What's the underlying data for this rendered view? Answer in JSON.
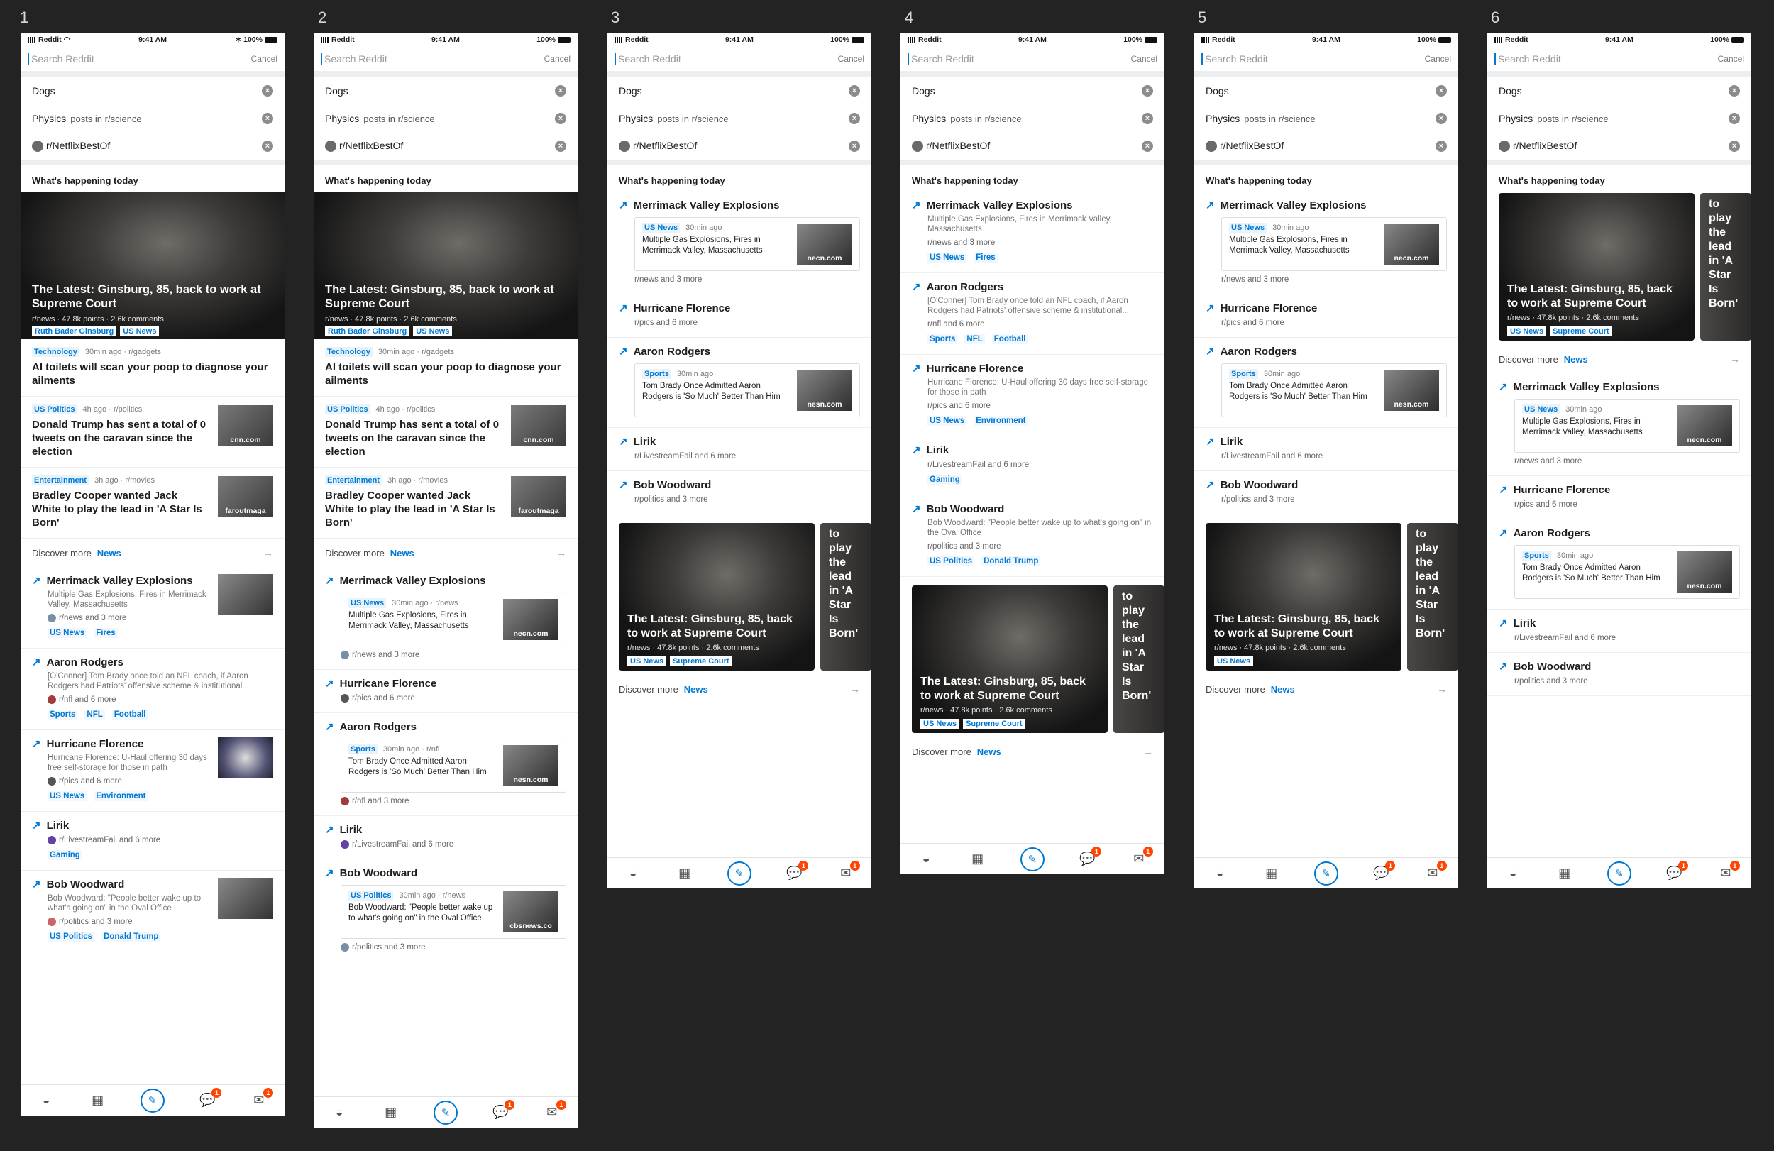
{
  "frame_labels": [
    "1",
    "2",
    "3",
    "4",
    "5",
    "6"
  ],
  "status": {
    "carrier": "Reddit",
    "time": "9:41 AM",
    "battery": "100%"
  },
  "search": {
    "placeholder": "Search Reddit",
    "cancel": "Cancel"
  },
  "recent": [
    {
      "label": "Dogs",
      "sub": ""
    },
    {
      "label": "Physics",
      "sub": "posts in r/science"
    },
    {
      "label": "r/NetflixBestOf",
      "sub": ""
    }
  ],
  "section_title": "What's happening today",
  "hero": {
    "title": "The Latest: Ginsburg, 85, back to work at Supreme Court",
    "meta": "r/news · 47.8k points · 2.6k comments",
    "tags_a": [
      "Ruth Bader Ginsburg",
      "US News"
    ],
    "tags_b": [
      "US News",
      "Supreme Court"
    ],
    "next_title": "Bradley Cooper wanted Jack White to play the lead in 'A Star Is Born'",
    "next_meta": "r/movies",
    "next_tag": "Entertainment"
  },
  "news": [
    {
      "cat": "Technology",
      "time": "30min ago",
      "sub": "r/gadgets",
      "title": "AI toilets will scan your poop to diagnose your ailments",
      "source": ""
    },
    {
      "cat": "US Politics",
      "time": "4h ago",
      "sub": "r/politics",
      "title": "Donald Trump has sent a total of 0 tweets on the caravan since the election",
      "source": "cnn.com"
    },
    {
      "cat": "Entertainment",
      "time": "3h ago",
      "sub": "r/movies",
      "title": "Bradley Cooper wanted Jack White to play the lead in 'A Star Is Born'",
      "source": "faroutmaga"
    }
  ],
  "discover": {
    "label": "Discover more",
    "link": "News"
  },
  "trending": {
    "merrimack": {
      "title": "Merrimack Valley Explosions",
      "desc": "Multiple Gas Explosions, Fires in Merrimack Valley, Massachusetts",
      "sub": "r/news and 3 more",
      "tags": [
        "US News",
        "Fires"
      ],
      "cat": "US News",
      "time": "30min ago",
      "subr": "r/news",
      "source": "necn.com"
    },
    "aaron": {
      "title": "Aaron Rodgers",
      "desc": "[O'Conner] Tom Brady once told an NFL coach, if Aaron Rodgers had Patriots' offensive scheme & institutional...",
      "sub": "r/nfl and 6 more",
      "tags": [
        "Sports",
        "NFL",
        "Football"
      ],
      "cat": "Sports",
      "time": "30min ago",
      "subr": "r/nfl",
      "nested_text": "Tom Brady Once Admitted Aaron Rodgers is 'So Much' Better Than Him",
      "nested_sub": "r/nfl and 3 more",
      "source": "nesn.com"
    },
    "hurricane": {
      "title": "Hurricane Florence",
      "desc": "Hurricane Florence: U-Haul offering 30 days free self-storage for those in path",
      "sub": "r/pics and 6 more",
      "tags": [
        "US News",
        "Environment"
      ]
    },
    "lirik": {
      "title": "Lirik",
      "sub": "r/LivestreamFail and 6 more",
      "tags": [
        "Gaming"
      ]
    },
    "bob": {
      "title": "Bob Woodward",
      "desc": "Bob Woodward: \"People better wake up to what's going on\" in the Oval Office",
      "sub": "r/politics and 3 more",
      "tags": [
        "US Politics",
        "Donald Trump"
      ],
      "cat": "US Politics",
      "time": "30min ago",
      "subr": "r/news",
      "source": "cbsnews.co"
    }
  },
  "tabs": {
    "chat_badge": "1",
    "mail_badge": "1"
  },
  "colors": {
    "accent": "#0079d3",
    "badge": "#ff4500",
    "background": "#232324"
  }
}
